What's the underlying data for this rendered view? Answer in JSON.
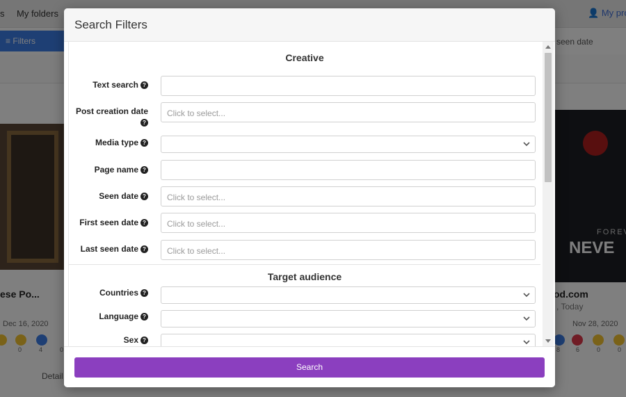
{
  "background": {
    "nav": [
      "s",
      "My folders"
    ],
    "profile": "My pro",
    "filters_label": "Filters",
    "seen_date_header": "seen date",
    "left_card_title": "ese Po...",
    "left_card_date": "Dec 16, 2020",
    "right_card_title": "od.com",
    "right_card_sub": ", Today",
    "right_card_date": "Nov 28, 2020",
    "right_image_text_small": "FOREV",
    "right_image_text_big": "NEVE",
    "detail_label": "Detail",
    "left_counts": [
      "0",
      "4",
      "0"
    ],
    "right_counts": [
      "8",
      "6",
      "0",
      "0"
    ]
  },
  "modal": {
    "title": "Search Filters",
    "section_creative": "Creative",
    "section_target": "Target audience",
    "help_glyph": "?",
    "fields": {
      "text_search": {
        "label": "Text search",
        "value": ""
      },
      "post_creation_date": {
        "label": "Post creation date",
        "placeholder": "Click to select..."
      },
      "media_type": {
        "label": "Media type",
        "value": ""
      },
      "page_name": {
        "label": "Page name",
        "value": ""
      },
      "seen_date": {
        "label": "Seen date",
        "placeholder": "Click to select..."
      },
      "first_seen_date": {
        "label": "First seen date",
        "placeholder": "Click to select..."
      },
      "last_seen_date": {
        "label": "Last seen date",
        "placeholder": "Click to select..."
      },
      "countries": {
        "label": "Countries",
        "value": ""
      },
      "language": {
        "label": "Language",
        "value": ""
      },
      "sex": {
        "label": "Sex",
        "value": ""
      }
    },
    "search_button": "Search"
  },
  "colors": {
    "primary_button": "#8b3fbf",
    "filter_bar": "#3d7ee8",
    "profile_link": "#3f6fd8"
  }
}
